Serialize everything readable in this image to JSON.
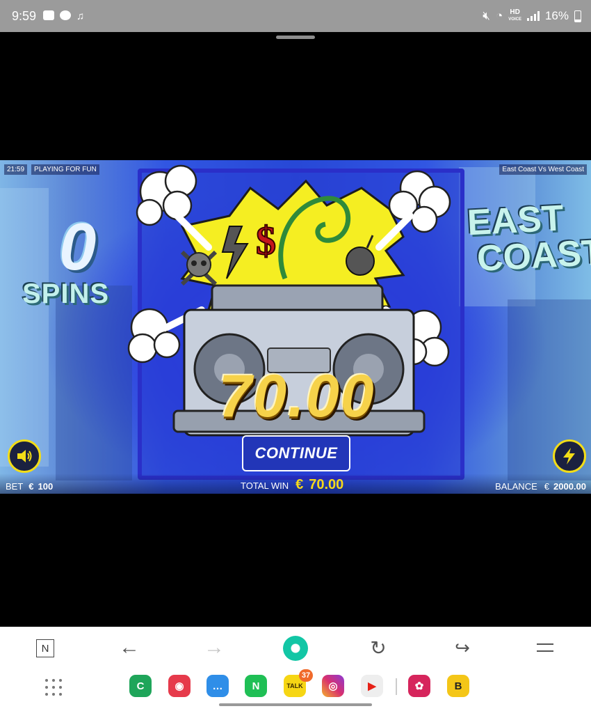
{
  "status_bar": {
    "time": "9:59",
    "battery": "16%",
    "icons": [
      "gallery-icon",
      "talk-icon",
      "music-icon",
      "mute-icon",
      "wifi-icon",
      "hd-voice-icon",
      "signal-icon",
      "battery-icon"
    ],
    "hd_label": "HD",
    "voice_label": "VOICE"
  },
  "game": {
    "clock": "21:59",
    "mode": "PLAYING FOR FUN",
    "title": "East Coast Vs West Coast",
    "spins_count": "0",
    "spins_label": "SPINS",
    "logo_line1": "EAST",
    "logo_line2": "COAST",
    "win_amount": "70.00",
    "continue_label": "CONTINUE",
    "bet_label": "BET",
    "bet_currency": "€",
    "bet_value": "100",
    "total_win_label": "TOTAL WIN",
    "total_win_currency": "€",
    "total_win_value": "70.00",
    "balance_label": "BALANCE",
    "balance_currency": "€",
    "balance_value": "2000.00",
    "accent_color": "#f3dd17"
  },
  "browser": {
    "n_label": "N",
    "back_glyph": "←",
    "forward_glyph": "→",
    "reload_glyph": "↻",
    "share_glyph": "↪",
    "apps": [
      {
        "name": "phone-app",
        "glyph": "C",
        "color": "#1fa55a"
      },
      {
        "name": "camera-app",
        "glyph": "◉",
        "color": "#e63a4b"
      },
      {
        "name": "messages-app",
        "glyph": "…",
        "color": "#2f8ee8"
      },
      {
        "name": "naver-app",
        "glyph": "N",
        "color": "#1fbf55"
      },
      {
        "name": "kakaotalk-app",
        "glyph": "TALK",
        "color": "#f6d614",
        "badge": "37"
      },
      {
        "name": "instagram-app",
        "glyph": "◎",
        "color": "#d8306e"
      },
      {
        "name": "youtube-app",
        "glyph": "▶",
        "color": "#eeeeee"
      },
      {
        "name": "blossom-app",
        "glyph": "✿",
        "color": "#d6255c"
      },
      {
        "name": "b-app",
        "glyph": "B",
        "color": "#f4c618"
      }
    ]
  }
}
